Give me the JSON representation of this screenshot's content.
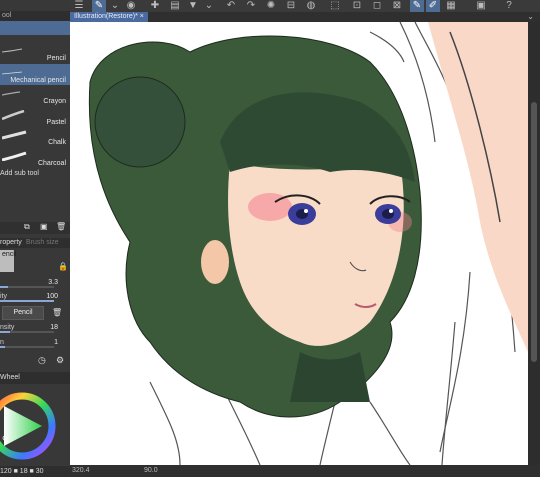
{
  "toolbar": {
    "title": ""
  },
  "tabs": [
    {
      "label": "Illustration(Restore)* ×"
    }
  ],
  "left_panel": {
    "subtools_header": "ool",
    "subtools": [
      {
        "label": "Pencil"
      },
      {
        "label": "Mechanical pencil"
      },
      {
        "label": "Crayon"
      },
      {
        "label": "Pastel"
      },
      {
        "label": "Chalk"
      },
      {
        "label": "Charcoal"
      }
    ],
    "add_sub_tool": "Add sub tool",
    "property_tabs": {
      "tab1": "roperty",
      "tab2": "Brush size"
    },
    "tool_name": "encil",
    "brush_size": {
      "label": "",
      "value": "3.3",
      "fraction": 0.15
    },
    "opacity": {
      "label": "ity",
      "value": "100",
      "fraction": 1.0
    },
    "preset_button": "Pencil",
    "density": {
      "label": "nsity",
      "value": "18",
      "fraction": 0.18
    },
    "stabilization": {
      "label": "n",
      "value": "1",
      "fraction": 0.1
    },
    "color_wheel": {
      "label": "Wheel"
    },
    "color_values": "120 ■ 18 ■ 30"
  },
  "status": {
    "zoom": "320.4",
    "angle": "90.0"
  },
  "colors": {
    "hair": "#3b5a3a",
    "hair_dark": "#2c4530",
    "skin": "#f8d5bf",
    "eye": "#3a3d9a",
    "blush": "#f27a8a",
    "accent": "#4b6aa0"
  }
}
